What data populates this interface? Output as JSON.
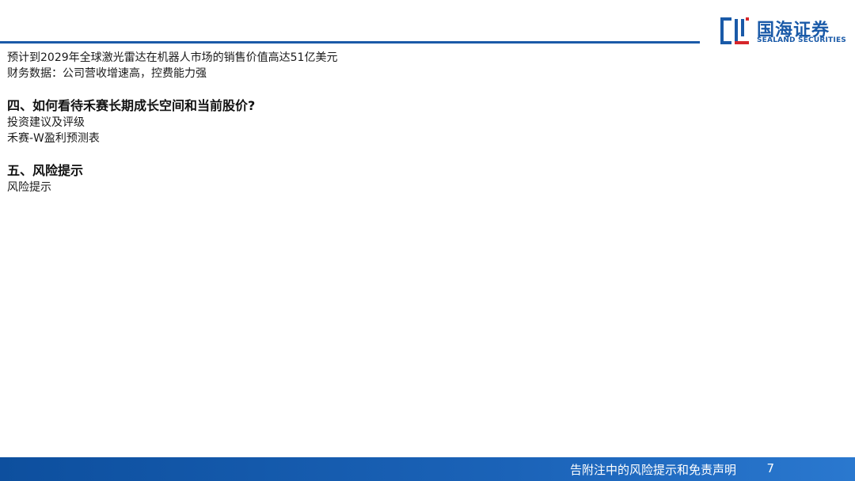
{
  "brand": {
    "name_cn": "国海证券",
    "name_en": "SEALAND SECURITIES",
    "color": "#1a5aa8"
  },
  "content": {
    "lines_top": [
      "预计到2029年全球激光雷达在机器人市场的销售价值高达51亿美元",
      "财务数据：公司营收增速高，控费能力强"
    ],
    "section4": {
      "title": "四、如何看待禾赛长期成长空间和当前股价?",
      "items": [
        "投资建议及评级",
        "禾赛-W盈利预测表"
      ]
    },
    "section5": {
      "title": "五、风险提示",
      "items": [
        "风险提示"
      ]
    }
  },
  "footer": {
    "disclaimer": "告附注中的风险提示和免责声明",
    "page_number": "7"
  }
}
